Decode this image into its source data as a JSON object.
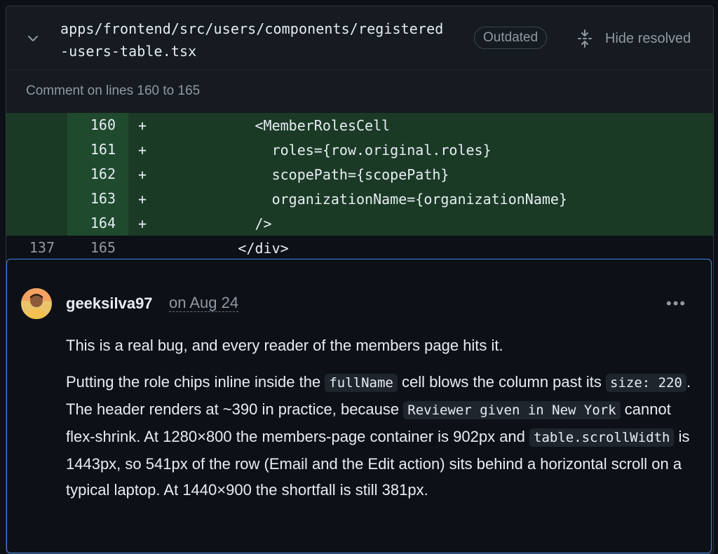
{
  "file": {
    "path_line1": "apps/frontend/src/users/components/registered",
    "path_line2": "-users-table.tsx",
    "badge": "Outdated",
    "hide_resolved": "Hide resolved"
  },
  "comment_on": "Comment on lines 160 to 165",
  "diff": [
    {
      "old": "",
      "new": "160",
      "sign": "+",
      "code": "            <MemberRolesCell",
      "added": true
    },
    {
      "old": "",
      "new": "161",
      "sign": "+",
      "code": "              roles={row.original.roles}",
      "added": true
    },
    {
      "old": "",
      "new": "162",
      "sign": "+",
      "code": "              scopePath={scopePath}",
      "added": true
    },
    {
      "old": "",
      "new": "163",
      "sign": "+",
      "code": "              organizationName={organizationName}",
      "added": true
    },
    {
      "old": "",
      "new": "164",
      "sign": "+",
      "code": "            />",
      "added": true
    },
    {
      "old": "137",
      "new": "165",
      "sign": "",
      "code": "          </div>",
      "added": false
    }
  ],
  "comment": {
    "author": "geeksilva97",
    "date": "on Aug 24",
    "more": "•••",
    "p1": "This is a real bug, and every reader of the members page hits it.",
    "p2": {
      "t1": "Putting the role chips inline inside the ",
      "c1": "fullName",
      "t2": " cell blows the column past its ",
      "c2": "size: 220",
      "t3": ". The header renders at ~390 in practice, because ",
      "c3": "Reviewer given in New York",
      "t4": " cannot flex-shrink. At 1280×800 the members-page container is 902px and ",
      "c4": "table.scrollWidth",
      "t5": " is 1443px, so 541px of the row (Email and the Edit action) sits behind a horizontal scroll on a typical laptop. At 1440×900 the shortfall is still 381px."
    }
  },
  "colors": {
    "background": "#0d1117",
    "added_line": "#1b3a26",
    "focus_border": "#4184e4"
  }
}
